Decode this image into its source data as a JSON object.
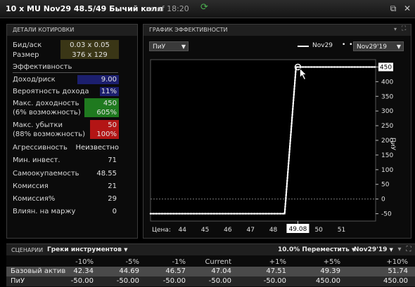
{
  "window": {
    "title": "10 x MU Nov29 48.5/49 Бычий колл",
    "as_of": "as of 18:20"
  },
  "quote": {
    "header": "ДЕТАЛИ КОТИРОВКИ",
    "bid_ask_label": "Бид/аск",
    "bid_ask_value": "0.03 x 0.05",
    "size_label": "Размер",
    "size_value": "376 x 129",
    "efficiency_link": "Эффективность",
    "rows": [
      {
        "label": "Доход/риск",
        "value": "9.00"
      },
      {
        "label": "Вероятность дохода",
        "value": "11%"
      },
      {
        "label": "Макс. доходность",
        "label2": "(6% возможность)",
        "value": "450",
        "value2": "605%"
      },
      {
        "label": "Макс. убытки",
        "label2": "(88% возможность)",
        "value": "50",
        "value2": "100%"
      },
      {
        "label": "Агрессивность",
        "value": "Неизвестно"
      },
      {
        "label": "Мин. инвест.",
        "value": "71"
      },
      {
        "label": "Самоокупаемость",
        "value": "48.55"
      },
      {
        "label": "Комиссия",
        "value": "21"
      },
      {
        "label": "Комиссия%",
        "value": "29"
      },
      {
        "label": "Влиян. на маржу",
        "value": "0"
      }
    ]
  },
  "chart_panel": {
    "header": "ГРАФИК ЭФФЕКТИВНОСТИ",
    "metric_dropdown": "ПиУ",
    "legend_solid": "Nov29",
    "legend_dotted_dropdown": "Nov29'19",
    "price_label": "Цена:",
    "cursor_price": "49.08",
    "cursor_value_badge": "450"
  },
  "chart_data": {
    "type": "line",
    "ylabel": "ПиУ",
    "xlabel": "Цена:",
    "xlim": [
      42.6,
      52.5
    ],
    "ylim": [
      -75,
      475
    ],
    "x_ticks": [
      44,
      45,
      46,
      47,
      48,
      50,
      51
    ],
    "y_ticks": [
      -50,
      0,
      50,
      100,
      150,
      200,
      250,
      300,
      350,
      400,
      450
    ],
    "series": [
      {
        "name": "Nov29",
        "style": "solid",
        "x": [
          42.6,
          48.5,
          49.0,
          52.5
        ],
        "y": [
          -50,
          -50,
          450,
          450
        ]
      },
      {
        "name": "Nov29'19",
        "style": "dotted",
        "x": [
          42.6,
          48.5,
          49.0,
          52.5
        ],
        "y": [
          -50,
          -50,
          450,
          450
        ]
      }
    ],
    "zero_line": true,
    "cursor": {
      "x": 49.08,
      "y": 450
    }
  },
  "scenarios": {
    "header": "СЦЕНАРИИ",
    "greeks_dropdown": "Греки инструментов",
    "shift_dropdown": "10.0% Переместить",
    "expiry_dropdown": "Nov29'19",
    "columns": [
      "-10%",
      "-5%",
      "-1%",
      "Current",
      "+1%",
      "+5%",
      "+10%"
    ],
    "rows": [
      {
        "label": "Базовый актив",
        "values": [
          "42.34",
          "44.69",
          "46.57",
          "47.04",
          "47.51",
          "49.39",
          "51.74"
        ]
      },
      {
        "label": "ПиУ",
        "values": [
          "-50.00",
          "-50.00",
          "-50.00",
          "-50.00",
          "-50.00",
          "450.00",
          "450.00"
        ]
      }
    ]
  },
  "colors": {
    "income_risk_bg": "#1c1f6e",
    "probability_bg": "#1c1f6e",
    "max_return_bg": "#1f7a1f",
    "max_loss_bg": "#b31515",
    "accent_green": "#4caf50"
  }
}
